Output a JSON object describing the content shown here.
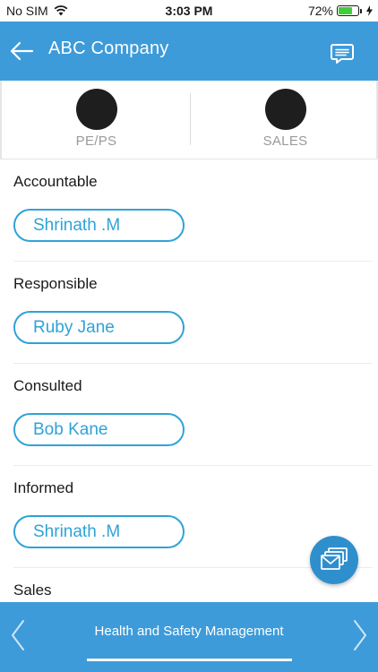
{
  "status_bar": {
    "carrier": "No SIM",
    "time": "3:03 PM",
    "battery_percent": "72%",
    "battery_level": 0.72,
    "wifi_icon": "wifi-icon",
    "charging_icon": "bolt-icon"
  },
  "header": {
    "title": "ABC Company",
    "back_icon": "arrow-left-icon",
    "chat_icon": "chat-icon",
    "color": "#3d9bd9"
  },
  "departments": [
    {
      "label": "PE/PS"
    },
    {
      "label": "SALES"
    }
  ],
  "sections": [
    {
      "title": "Accountable",
      "person": "Shrinath .M"
    },
    {
      "title": "Responsible",
      "person": "Ruby Jane"
    },
    {
      "title": "Consulted",
      "person": "Bob Kane"
    },
    {
      "title": "Informed",
      "person": "Shrinath .M"
    },
    {
      "title": "Sales"
    }
  ],
  "fab": {
    "icon": "mail-stack-icon"
  },
  "bottom_nav": {
    "title": "Health and Safety Management",
    "prev_icon": "chevron-left-icon",
    "next_icon": "chevron-right-icon"
  },
  "accent_color": "#2fa3d6"
}
